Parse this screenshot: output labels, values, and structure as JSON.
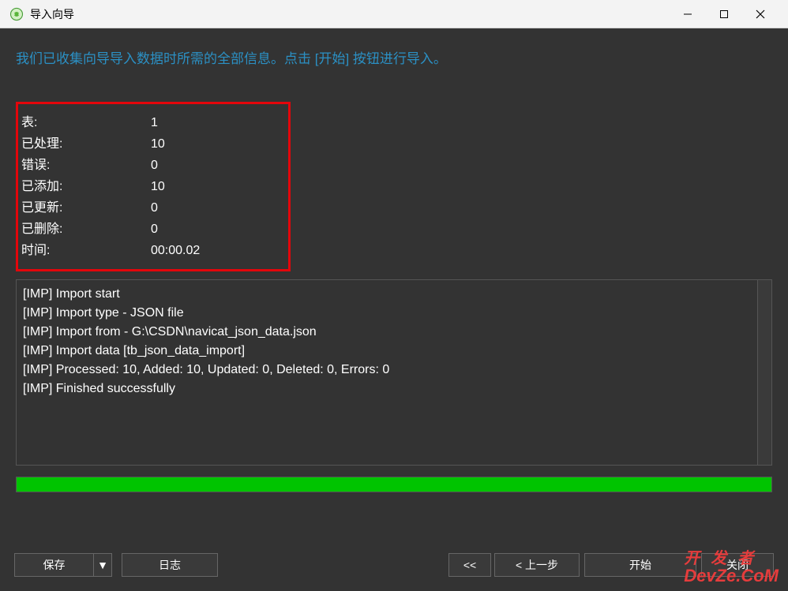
{
  "window": {
    "title": "导入向导"
  },
  "header": {
    "description": "我们已收集向导导入数据时所需的全部信息。点击 [开始] 按钮进行导入。"
  },
  "stats": {
    "tables_label": "表:",
    "tables_value": "1",
    "processed_label": "已处理:",
    "processed_value": "10",
    "errors_label": "错误:",
    "errors_value": "0",
    "added_label": "已添加:",
    "added_value": "10",
    "updated_label": "已更新:",
    "updated_value": "0",
    "deleted_label": "已删除:",
    "deleted_value": "0",
    "time_label": "时间:",
    "time_value": "00:00.02"
  },
  "log": {
    "lines": [
      "[IMP] Import start",
      "[IMP] Import type - JSON file",
      "[IMP] Import from - G:\\CSDN\\navicat_json_data.json",
      "[IMP] Import data [tb_json_data_import]",
      "[IMP] Processed: 10, Added: 10, Updated: 0, Deleted: 0, Errors: 0",
      "[IMP] Finished successfully"
    ]
  },
  "footer": {
    "save_label": "保存",
    "save_dropdown": "▼",
    "log_label": "日志",
    "first_label": "<<",
    "prev_label": "< 上一步",
    "start_label": "开始",
    "close_label": "关闭"
  },
  "watermark": {
    "line1": "开发者",
    "line2": "DevZe.CoM"
  }
}
